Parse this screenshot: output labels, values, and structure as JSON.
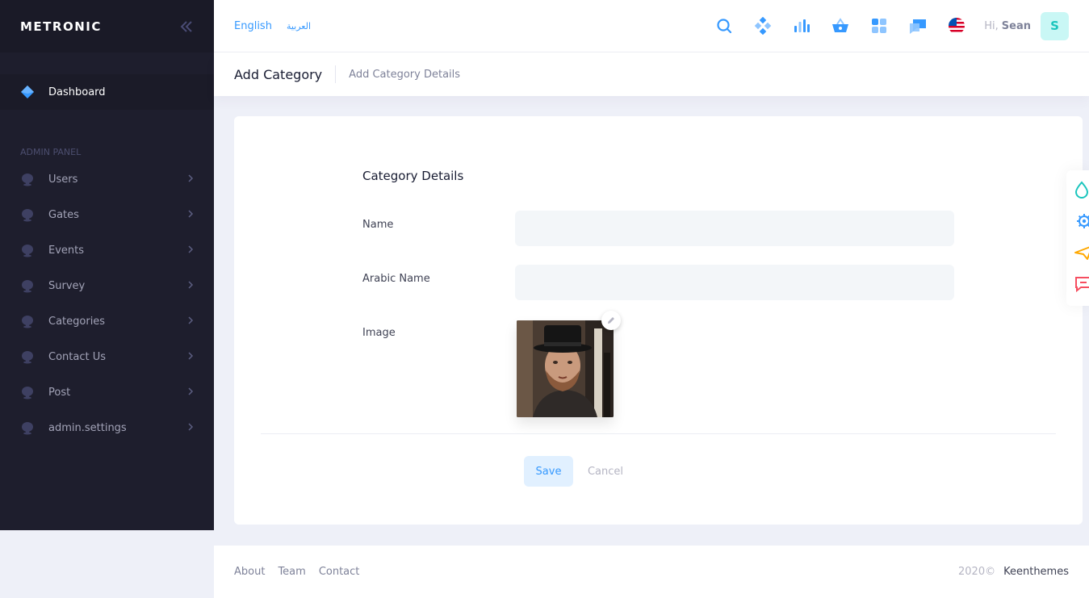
{
  "brand": {
    "logo_text": "METRONIC",
    "toggle_icon": "double-chevron-left-icon"
  },
  "sidebar": {
    "items": [
      {
        "label": "Dashboard",
        "icon": "layers-icon",
        "active": true
      }
    ],
    "section_title": "ADMIN PANEL",
    "admin_items": [
      {
        "label": "Users",
        "icon": "dot-icon"
      },
      {
        "label": "Gates",
        "icon": "dot-icon"
      },
      {
        "label": "Events",
        "icon": "dot-icon"
      },
      {
        "label": "Survey",
        "icon": "dot-icon"
      },
      {
        "label": "Categories",
        "icon": "dot-icon"
      },
      {
        "label": "Contact Us",
        "icon": "dot-icon"
      },
      {
        "label": "Post",
        "icon": "dot-icon"
      },
      {
        "label": "admin.settings",
        "icon": "dot-icon"
      }
    ]
  },
  "header": {
    "languages": [
      "English",
      "العربية"
    ],
    "topbar_icons": [
      "search-icon",
      "diamond-grid-icon",
      "bar-chart-icon",
      "basket-icon",
      "apps-grid-icon",
      "chat-icon",
      "us-flag-icon"
    ],
    "greeting": "Hi,",
    "user_name": "Sean",
    "avatar_letter": "S"
  },
  "subheader": {
    "title": "Add Category",
    "description": "Add Category Details"
  },
  "form": {
    "section_title": "Category Details",
    "name_label": "Name",
    "name_value": "",
    "arabic_name_label": "Arabic Name",
    "arabic_name_value": "",
    "image_label": "Image",
    "save_label": "Save",
    "cancel_label": "Cancel"
  },
  "sticky_toolbar": [
    "drop-icon",
    "gear-icon",
    "paper-plane-icon",
    "chat-bubble-icon"
  ],
  "footer": {
    "links": [
      "About",
      "Team",
      "Contact"
    ],
    "year": "2020©",
    "brand": "Keenthemes"
  },
  "colors": {
    "primary": "#3699FF",
    "sidebar_bg": "#1E1E2D",
    "brand_bg": "#1A1A27",
    "avatar_bg": "#C9F7F5",
    "avatar_text": "#1BC5BD"
  }
}
